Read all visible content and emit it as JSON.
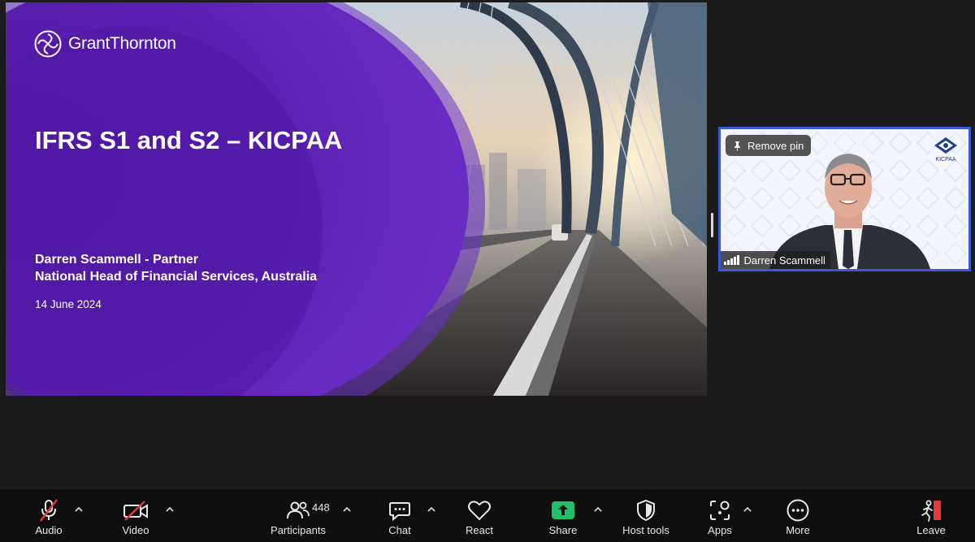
{
  "slide": {
    "logo_text": "GrantThornton",
    "title": "IFRS S1 and S2 – KICPAA",
    "presenter_line1": "Darren Scammell - Partner",
    "presenter_line2": "National Head of Financial Services, Australia",
    "date": "14 June 2024"
  },
  "video_tile": {
    "pin_button_label": "Remove pin",
    "participant_name": "Darren Scammell",
    "logo_text": "KICPAA"
  },
  "toolbar": {
    "audio_label": "Audio",
    "video_label": "Video",
    "participants_label": "Participants",
    "participants_count": "448",
    "chat_label": "Chat",
    "react_label": "React",
    "share_label": "Share",
    "host_tools_label": "Host tools",
    "apps_label": "Apps",
    "more_label": "More",
    "leave_label": "Leave"
  },
  "colors": {
    "slide_purple": "#5a1fb0",
    "share_green": "#21c16b",
    "leave_red": "#e5393a",
    "tile_border": "#3b59d6"
  }
}
